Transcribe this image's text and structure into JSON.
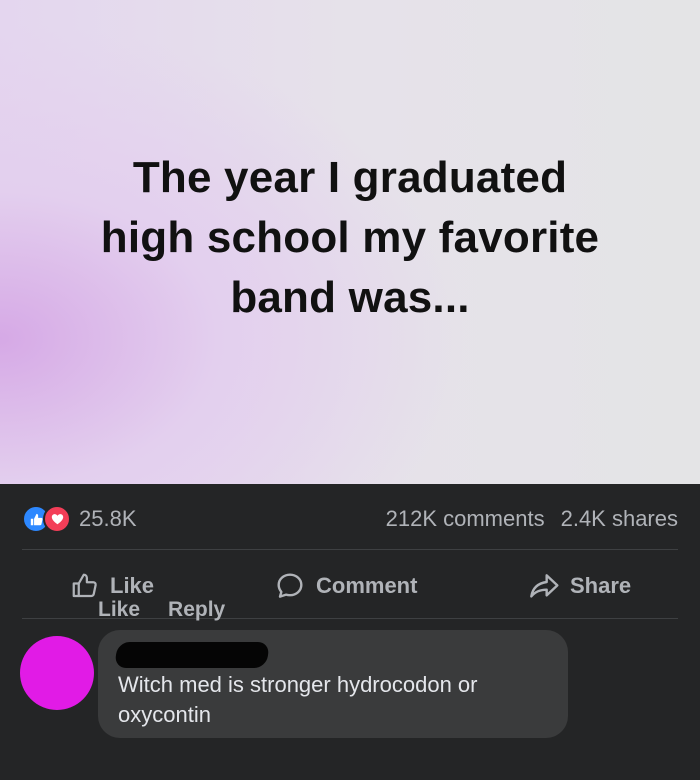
{
  "post": {
    "image_text_lines": [
      "The year I graduated",
      "high school my favorite",
      "band was..."
    ]
  },
  "stats": {
    "reaction_count": "25.8K",
    "comments": "212K comments",
    "shares": "2.4K shares",
    "reaction_icons": [
      "like-icon",
      "love-icon"
    ]
  },
  "actions": {
    "like": "Like",
    "comment": "Comment",
    "share": "Share"
  },
  "comment": {
    "text": "Witch med is stronger hydrocodon or oxycontin",
    "like": "Like",
    "reply": "Reply",
    "avatar_color": "#e11be6"
  },
  "colors": {
    "background": "#242526",
    "like_blue": "#2d88ff",
    "love_red": "#f33e58",
    "muted_text": "#b0b3b8"
  }
}
